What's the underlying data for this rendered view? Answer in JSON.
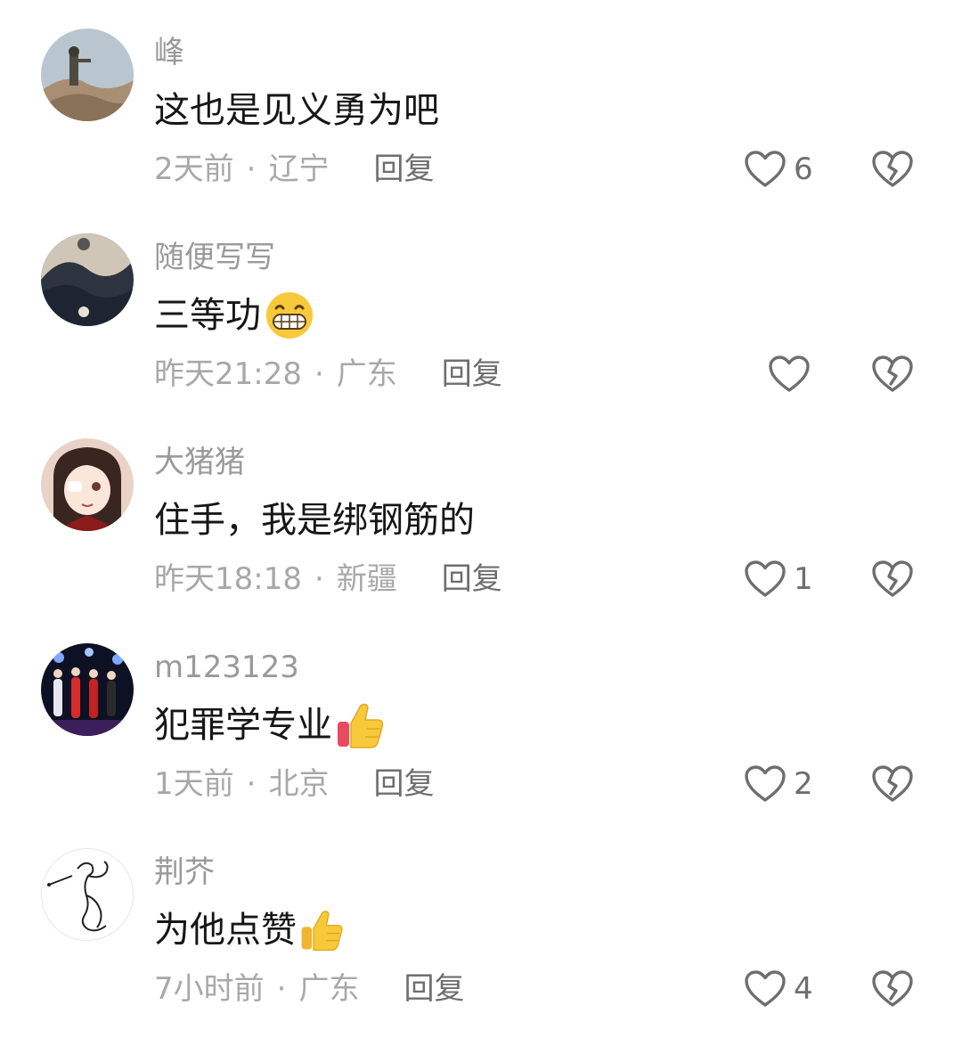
{
  "comments": [
    {
      "username": "峰",
      "text": "这也是见义勇为吧",
      "emoji": "",
      "time": "2天前",
      "separator": "·",
      "location": "辽宁",
      "reply_label": "回复",
      "likes": "6"
    },
    {
      "username": "随便写写",
      "text": "三等功",
      "emoji": "grinning-face-emoji",
      "time": "昨天21:28",
      "separator": "·",
      "location": "广东",
      "reply_label": "回复",
      "likes": ""
    },
    {
      "username": "大猪猪",
      "text": "住手，我是绑钢筋的",
      "emoji": "",
      "time": "昨天18:18",
      "separator": "·",
      "location": "新疆",
      "reply_label": "回复",
      "likes": "1"
    },
    {
      "username": "m123123",
      "text": "犯罪学专业",
      "emoji": "thumbs-up-emoji",
      "time": "1天前",
      "separator": "·",
      "location": "北京",
      "reply_label": "回复",
      "likes": "2"
    },
    {
      "username": "荆芥",
      "text": "为他点赞",
      "emoji": "thumbs-up-emoji",
      "time": "7小时前",
      "separator": "·",
      "location": "广东",
      "reply_label": "回复",
      "likes": "4"
    }
  ],
  "icons": {
    "like": "heart-outline-icon",
    "dislike": "broken-heart-icon"
  },
  "colors": {
    "username": "#9a9a9a",
    "body_text": "#161616",
    "meta_text": "#a8a8a8",
    "reply_text": "#6e6e6e",
    "icon_stroke": "#6e6e6e",
    "emoji_yellow": "#f7c93b"
  }
}
